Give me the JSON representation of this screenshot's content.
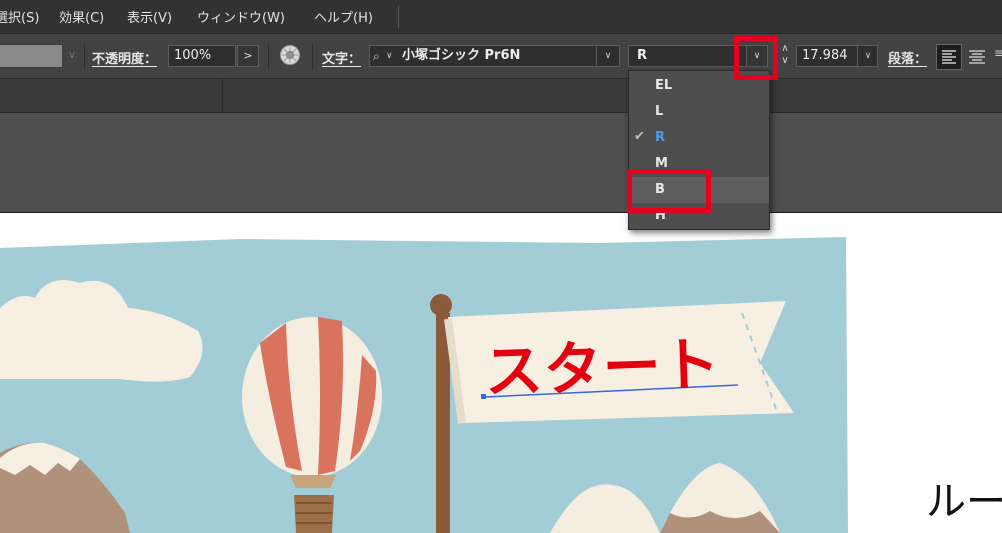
{
  "menubar": {
    "items": [
      {
        "label": "選択(S)",
        "name": "menu-select"
      },
      {
        "label": "効果(C)",
        "name": "menu-effect"
      },
      {
        "label": "表示(V)",
        "name": "menu-view"
      },
      {
        "label": "ウィンドウ(W)",
        "name": "menu-window"
      },
      {
        "label": "ヘルプ(H)",
        "name": "menu-help"
      }
    ]
  },
  "controlbar": {
    "opacity_label": "不透明度：",
    "opacity_value": "100%",
    "character_label": "文字：",
    "font_family": "小塚ゴシック Pr6N",
    "font_style": "R",
    "font_size": "17.984",
    "paragraph_label": "段落："
  },
  "dropdown": {
    "options": [
      {
        "label": "EL",
        "selected": false
      },
      {
        "label": "L",
        "selected": false
      },
      {
        "label": "R",
        "selected": true
      },
      {
        "label": "M",
        "selected": false
      },
      {
        "label": "B",
        "selected": false,
        "highlighted": true
      },
      {
        "label": "H",
        "selected": false
      }
    ]
  },
  "artwork": {
    "flag_text": "スタート",
    "side_text": "ルー"
  },
  "colors": {
    "highlight": "#e6001f",
    "selected_text": "#4a9bf0",
    "sky": "#a3cdd6",
    "flag": "#f7efe2",
    "balloon_red": "#d9735e",
    "pole": "#8a5a3b"
  }
}
